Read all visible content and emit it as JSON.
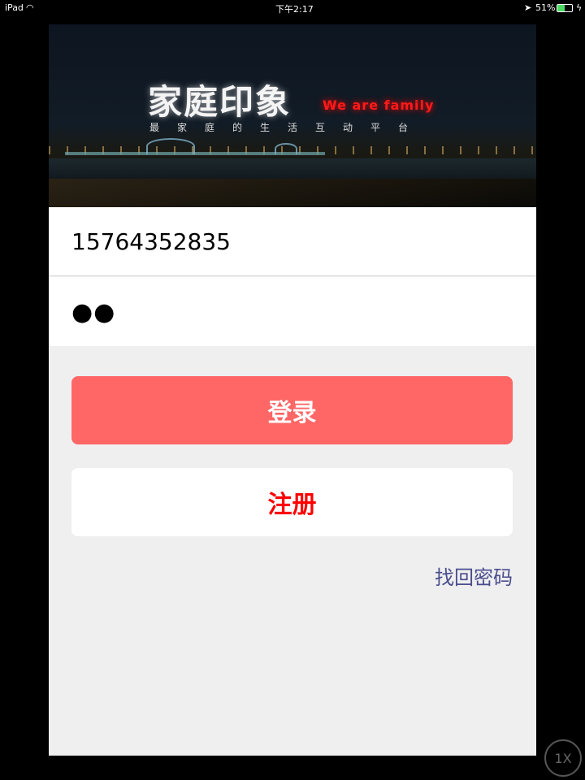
{
  "status_bar": {
    "device": "iPad",
    "time": "下午2:17",
    "battery": "51%",
    "battery_level": 51
  },
  "banner": {
    "title": "家庭印象",
    "slogan": "We are family",
    "subtitle": "最家庭的生活互动平台"
  },
  "form": {
    "phone": "15764352835",
    "password_mask": "●●"
  },
  "buttons": {
    "login": "登录",
    "register": "注册",
    "forgot": "找回密码"
  },
  "zoom_badge": "1X"
}
